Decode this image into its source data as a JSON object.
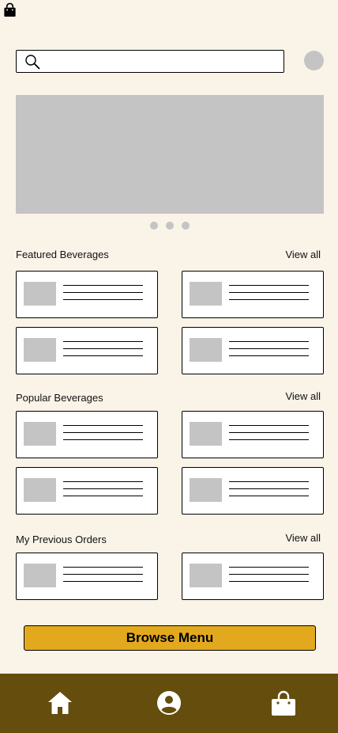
{
  "search": {
    "placeholder": "",
    "value": "",
    "icon": "search-icon"
  },
  "header": {
    "bag_icon": "shopping-bag-icon",
    "avatar_color": "#C4C4C4"
  },
  "carousel": {
    "slide_count": 3,
    "active_index": 0
  },
  "sections": [
    {
      "title": "Featured Beverages",
      "view_all": "View all"
    },
    {
      "title": "Popular Beverages",
      "view_all": "View all"
    },
    {
      "title": "My Previous Orders",
      "view_all": "View all"
    }
  ],
  "browse": {
    "label": "Browse Menu"
  },
  "nav": {
    "items": [
      {
        "icon": "home-icon"
      },
      {
        "icon": "profile-icon"
      },
      {
        "icon": "shopping-bag-icon"
      }
    ]
  },
  "colors": {
    "background": "#FAF3E8",
    "placeholder_gray": "#C4C4C4",
    "accent": "#E3A91E",
    "nav_bar": "#654D0E"
  }
}
